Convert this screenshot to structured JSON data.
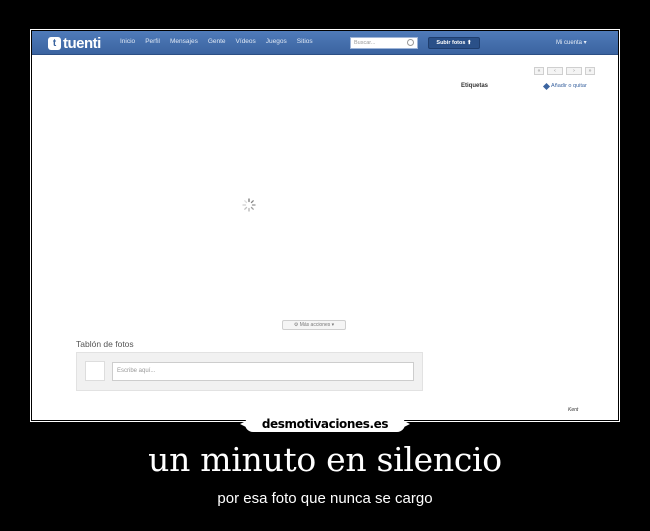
{
  "header": {
    "logo_mark": "t",
    "logo_text": "tuenti",
    "nav": [
      "Inicio",
      "Perfil",
      "Mensajes",
      "Gente",
      "Vídeos",
      "Juegos",
      "Sitios"
    ],
    "search_placeholder": "Buscar...",
    "upload_label": "Subir fotos ⬆",
    "account_label": "Mi cuenta ▾"
  },
  "pager": [
    "«",
    "‹",
    "›",
    "»"
  ],
  "sidebar": {
    "tags_label": "Etiquetas",
    "add_tag_label": "Añadir o quitar"
  },
  "more_actions_label": "⚙ Más acciones ▾",
  "board": {
    "title": "Tablón de fotos",
    "comment_placeholder": "Escribe aquí..."
  },
  "signature": "Kent",
  "site_badge": "desmotivaciones.es",
  "caption": {
    "title": "un minuto en silencio",
    "subtitle": "por esa foto que nunca se cargo"
  },
  "colors": {
    "topbar": "#3b64a0",
    "background": "#000000"
  }
}
